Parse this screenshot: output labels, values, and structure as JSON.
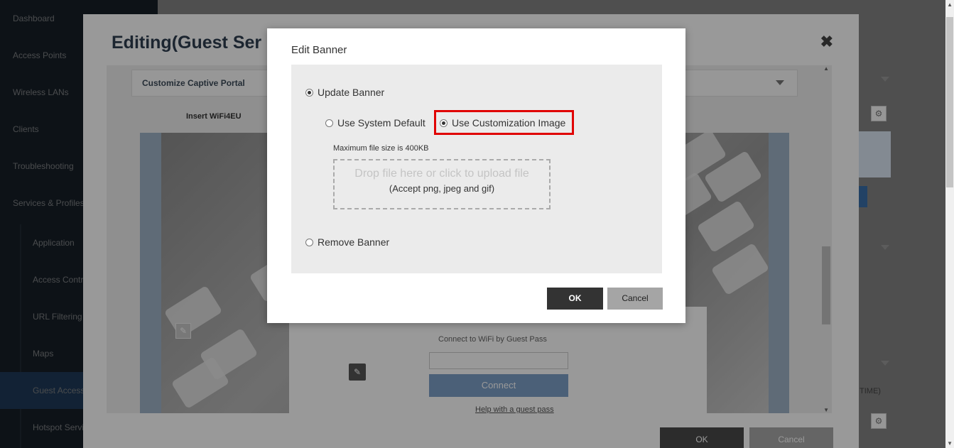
{
  "sidebar": {
    "items": [
      {
        "label": "Dashboard"
      },
      {
        "label": "Access Points"
      },
      {
        "label": "Wireless LANs"
      },
      {
        "label": "Clients"
      },
      {
        "label": "Troubleshooting"
      },
      {
        "label": "Services & Profiles"
      }
    ],
    "sub_items": [
      {
        "label": "Application"
      },
      {
        "label": "Access Control"
      },
      {
        "label": "URL Filtering"
      },
      {
        "label": "Maps"
      },
      {
        "label": "Guest Access"
      },
      {
        "label": "Hotspot Services"
      }
    ]
  },
  "edit_modal": {
    "title": "Editing(Guest Ser",
    "close_icon": "✖",
    "portal_header": "Customize Captive Portal",
    "insert_label": "Insert WiFi4EU",
    "guest_card": {
      "prompt": "Connect to WiFi by Guest Pass",
      "connect_label": "Connect",
      "help_link": "Help with a guest pass"
    },
    "ok_label": "OK",
    "cancel_label": "Cancel"
  },
  "background": {
    "time_text": "TIME)"
  },
  "banner_dialog": {
    "title": "Edit Banner",
    "update_label": "Update Banner",
    "system_default_label": "Use System Default",
    "custom_image_label": "Use Customization Image",
    "max_size_label": "Maximum file size is 400KB",
    "drop_main": "Drop file here or click to upload file",
    "drop_sub": "(Accept png, jpeg and gif)",
    "remove_label": "Remove Banner",
    "ok_label": "OK",
    "cancel_label": "Cancel",
    "selected_option": "update_banner",
    "selected_source": "customization_image",
    "highlight_color": "#e00000"
  }
}
